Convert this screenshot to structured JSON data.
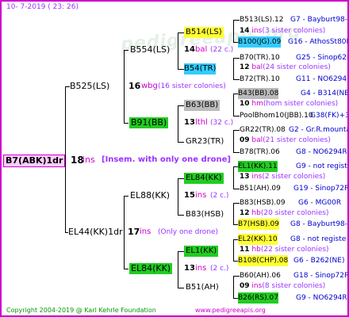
{
  "header": {
    "date": "10-  7-2019 (  23:  26)"
  },
  "watermark": "pedigreeapis.org",
  "footer": {
    "copyright": "Copyright 2004-2019 @ Karl Kehrle Foundation",
    "url": "www.pedigreeapis.org"
  },
  "colors": {
    "frame": "#cc00cc",
    "green": "#22cc22",
    "yellow": "#ffff33",
    "cyan": "#33ccff",
    "grey": "#bbbbbb",
    "pink": "#ffccff",
    "red": "#cc0000",
    "purple": "#9933ff",
    "blue": "#0000cc",
    "magenta": "#cc00cc"
  },
  "root": {
    "name": "B7(ABK)1dr",
    "num": "18",
    "code": "ins",
    "note": "[Insem. with only one drone]"
  },
  "gen1": [
    {
      "name": "B525(LS)",
      "num": "16",
      "code": "wbg",
      "note": "(16 sister colonies)"
    },
    {
      "name": "EL44(KK)1dr",
      "num": "17",
      "code": "ins",
      "note": "(Only one drone)"
    }
  ],
  "gen2": [
    {
      "name": "B554(LS)",
      "num": "14",
      "code": "bal",
      "note": "(22 c.)"
    },
    {
      "name": "B91(BB)",
      "num": "13",
      "code": "lthl",
      "note": "(32 c.)"
    },
    {
      "name": "EL88(KK)",
      "num": "15",
      "code": "ins",
      "note": "(2 c.)"
    },
    {
      "name": "EL84(KK)",
      "num": "13",
      "code": "ins",
      "note": "(2 c.)"
    }
  ],
  "gen3": [
    {
      "name": "B514(LS)",
      "num": "14",
      "code": "ins",
      "note": "(3 sister colonies)"
    },
    {
      "name": "B54(TR)",
      "num": "12",
      "code": "bal",
      "note": "(24 sister colonies)"
    },
    {
      "name": "B63(BB)",
      "num": "10",
      "code": "hm",
      "note": "(hom sister colonies)"
    },
    {
      "name": "GR23(TR)",
      "num": "09",
      "code": "bal",
      "note": "(21 sister colonies)"
    },
    {
      "name": "EL84(KK)",
      "num": "13",
      "code": "ins",
      "note": "(2 sister colonies)"
    },
    {
      "name": "B83(HSB)",
      "num": "12",
      "code": "hb",
      "note": "(20 sister colonies)"
    },
    {
      "name": "EL1(KK)",
      "num": "11",
      "code": "hb",
      "note": "(22 sister colonies)"
    },
    {
      "name": "B51(AH)",
      "num": "09",
      "code": "ins",
      "note": "(8 sister colonies)"
    }
  ],
  "gen4": [
    {
      "name": "B513(LS).12",
      "info": "G7 - Bayburt98-3"
    },
    {
      "name": "B100(JG).09",
      "info": "G16 - AthosSt80R"
    },
    {
      "name": "B70(TR).10",
      "info": "G25 - Sinop62R"
    },
    {
      "name": "B72(TR).10",
      "info": "G11 - NO6294R"
    },
    {
      "name": "B43(BB).08",
      "info": "G4 - B314(NE)"
    },
    {
      "name": "PoolBhom10(JBB).10",
      "info": "G38(FK)+3"
    },
    {
      "name": "GR22(TR).08",
      "info": "G2 - Gr.R.mounta"
    },
    {
      "name": "B78(TR).06",
      "info": "G8 - NO6294R"
    },
    {
      "name": "EL1(KK).11",
      "info": "G9 - not registe"
    },
    {
      "name": "B51(AH).09",
      "info": "G19 - Sinop72R"
    },
    {
      "name": "B83(HSB).09",
      "info": "G6 - MG00R"
    },
    {
      "name": "B7(HSB).09",
      "info": "G8 - Bayburt98-3"
    },
    {
      "name": "EL2(KK).10",
      "info": "G8 - not registe"
    },
    {
      "name": "B108(CHP).08",
      "info": "G6 - B262(NE)"
    },
    {
      "name": "B60(AH).06",
      "info": "G18 - Sinop72R"
    },
    {
      "name": "B26(RS).07",
      "info": "G9 - NO6294R"
    }
  ]
}
